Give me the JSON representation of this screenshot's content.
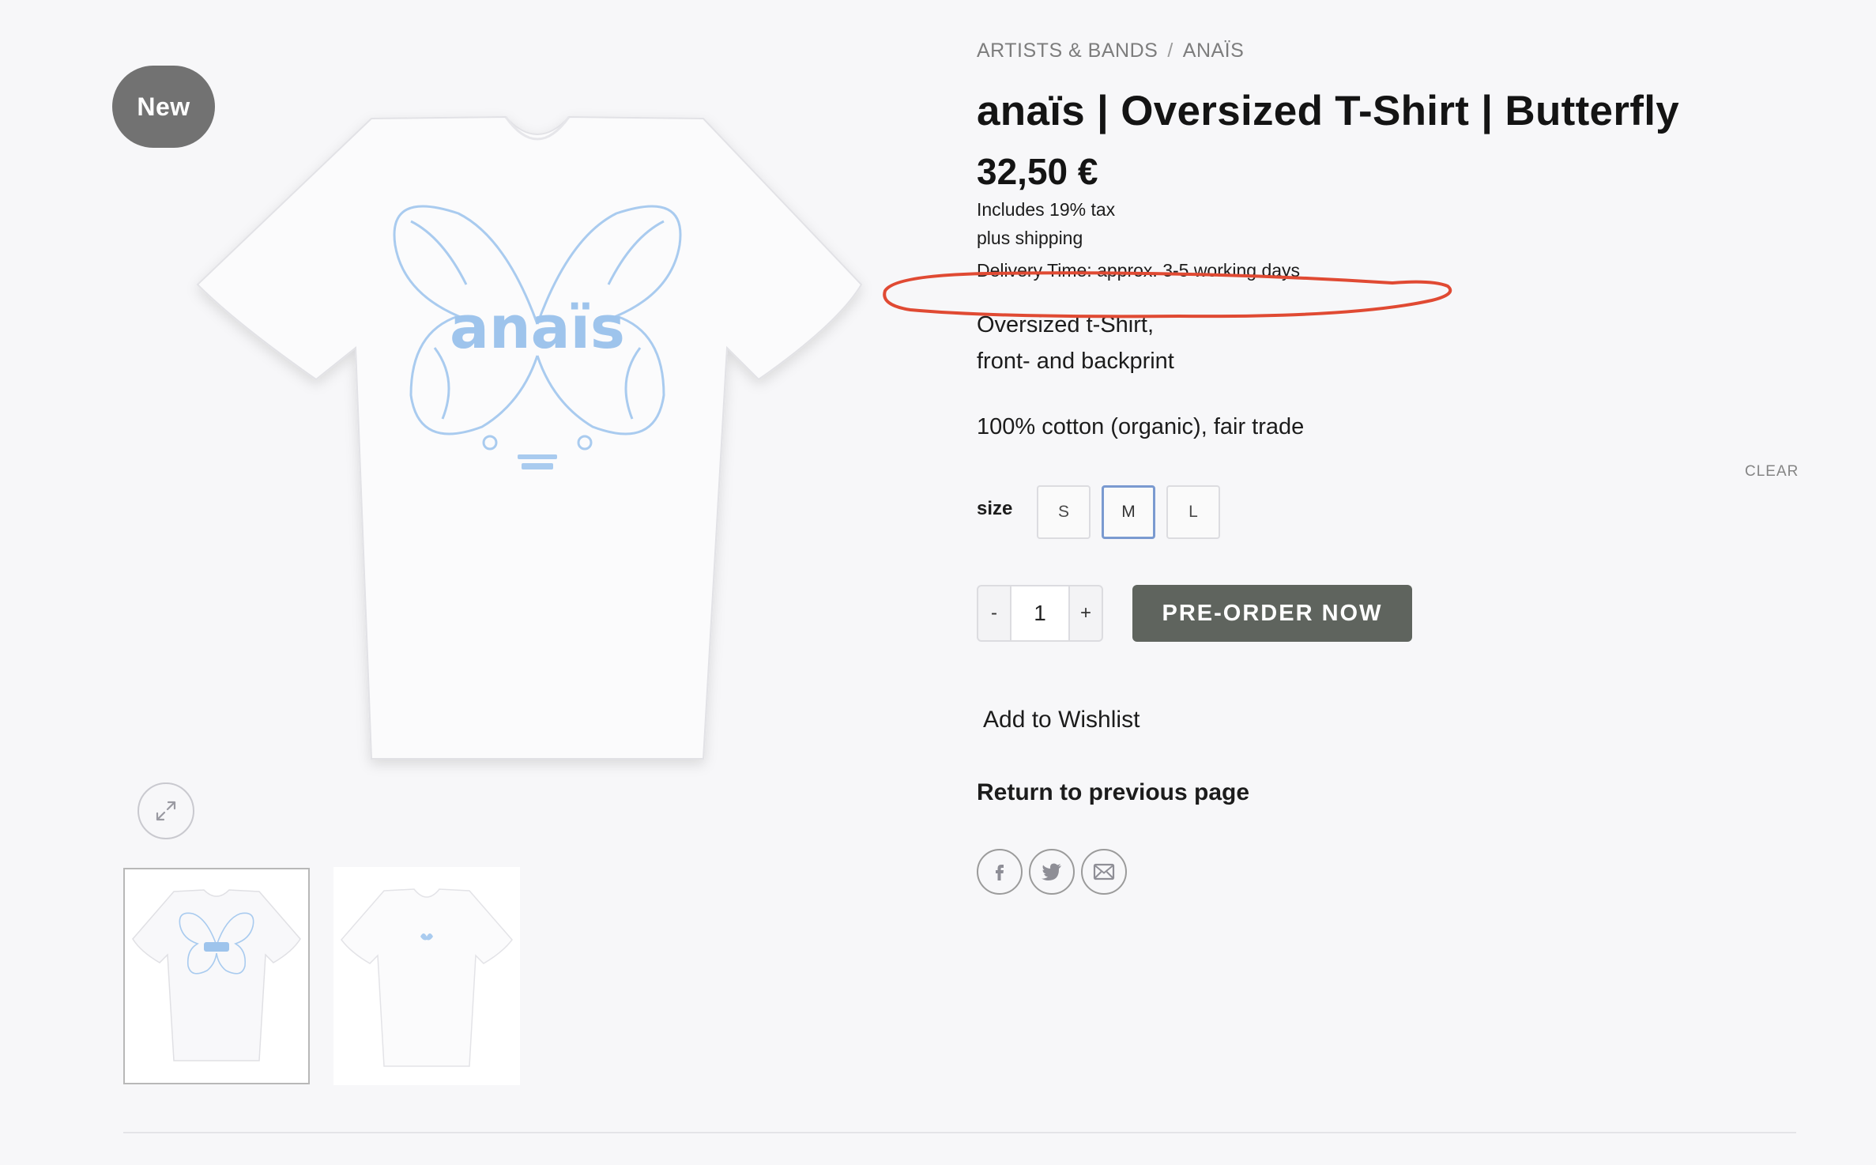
{
  "badge": {
    "label": "New"
  },
  "shirt_print": {
    "brand_text": "anaïs"
  },
  "breadcrumb": {
    "items": [
      "ARTISTS & BANDS",
      "ANAÏS"
    ],
    "separator": "/"
  },
  "product": {
    "title": "anaïs | Oversized T-Shirt | Butterfly",
    "price": "32,50 €",
    "tax_note": "Includes 19% tax",
    "shipping_note": "plus shipping",
    "delivery_note": "Delivery Time: approx. 3-5 working days",
    "description": [
      "Oversized t-Shirt,",
      "front- and backprint",
      "100% cotton (organic), fair trade"
    ]
  },
  "variations": {
    "label": "size",
    "options": [
      "S",
      "M",
      "L"
    ],
    "selected": "M",
    "clear_label": "CLEAR"
  },
  "cart": {
    "minus": "-",
    "plus": "+",
    "quantity": "1",
    "button_label": "PRE-ORDER NOW"
  },
  "links": {
    "wishlist": "Add to Wishlist",
    "return": "Return to previous page"
  },
  "share": {
    "icons": [
      "facebook-icon",
      "twitter-icon",
      "email-icon"
    ]
  },
  "colors": {
    "badge": "#727272",
    "button": "#5f645e",
    "selected_size": "#7a9ad0",
    "print_blue": "#9ec4ec",
    "annotation": "#e04a33"
  }
}
